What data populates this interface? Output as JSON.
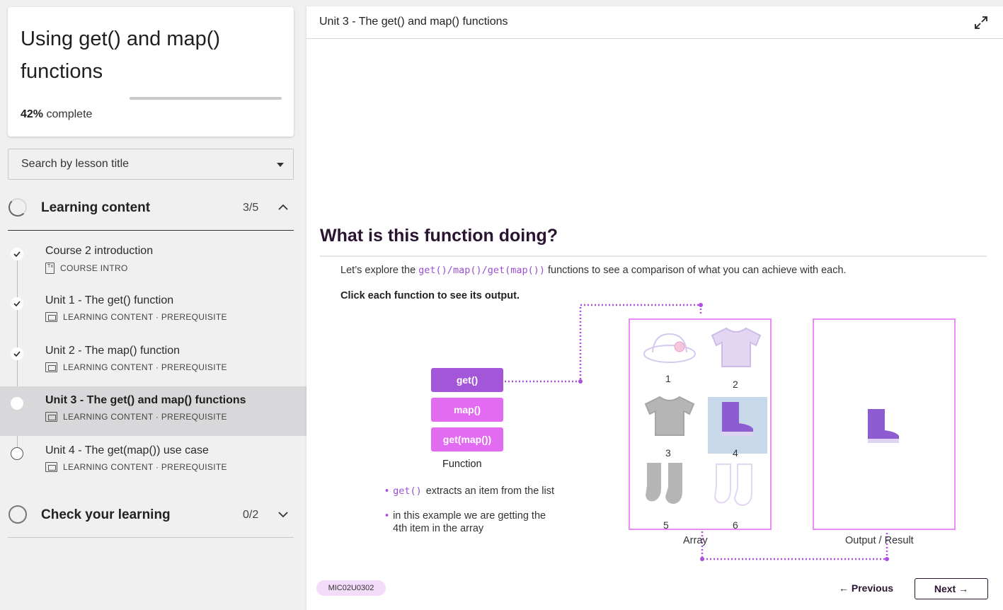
{
  "course": {
    "title": "Using get() and map() functions",
    "progress_percent": "42%",
    "progress_suffix": "complete",
    "progress_fraction": 0.42
  },
  "search": {
    "placeholder": "Search by lesson title"
  },
  "sections": [
    {
      "title": "Learning content",
      "count": "3/5",
      "expanded": true
    },
    {
      "title": "Check your learning",
      "count": "0/2",
      "expanded": false
    }
  ],
  "lessons": [
    {
      "title": "Course 2 introduction",
      "meta": "COURSE INTRO",
      "status": "done",
      "icon": "doc-icon"
    },
    {
      "title": "Unit 1 - The get() function",
      "meta": "LEARNING CONTENT · PREREQUISITE",
      "status": "done",
      "icon": "screen-icon"
    },
    {
      "title": "Unit 2 - The map() function",
      "meta": "LEARNING CONTENT · PREREQUISITE",
      "status": "done",
      "icon": "screen-icon"
    },
    {
      "title": "Unit 3 - The get() and map() functions",
      "meta": "LEARNING CONTENT · PREREQUISITE",
      "status": "current",
      "icon": "screen-icon"
    },
    {
      "title": "Unit 4 - The get(map()) use case",
      "meta": "LEARNING CONTENT · PREREQUISITE",
      "status": "todo",
      "icon": "screen-icon"
    }
  ],
  "main": {
    "header_title": "Unit 3 - The get() and map() functions",
    "heading": "What is this function doing?",
    "intro_before": "Let’s explore the ",
    "intro_code": "get()/map()/get(map())",
    "intro_after": " functions to see a comparison of what you can achieve with each.",
    "instruction": "Click each function to see its output.",
    "functions": [
      "get()",
      "map()",
      "get(map())"
    ],
    "function_caption": "Function",
    "bullets": [
      {
        "code": "get()",
        "text": "extracts an item from the list"
      },
      {
        "line1": "in this example we are getting the",
        "line2": "4th item in the array"
      }
    ],
    "array_labels": [
      "1",
      "2",
      "3",
      "4",
      "5",
      "6"
    ],
    "array_caption": "Array",
    "output_caption": "Output / Result",
    "badge": "MIC02U0302",
    "prev_label": "← Previous",
    "next_label": "Next →",
    "colors": {
      "primary": "#a456d8",
      "pink": "#e26bf2",
      "box": "#ea8cf6",
      "dark": "#2b1431"
    }
  }
}
